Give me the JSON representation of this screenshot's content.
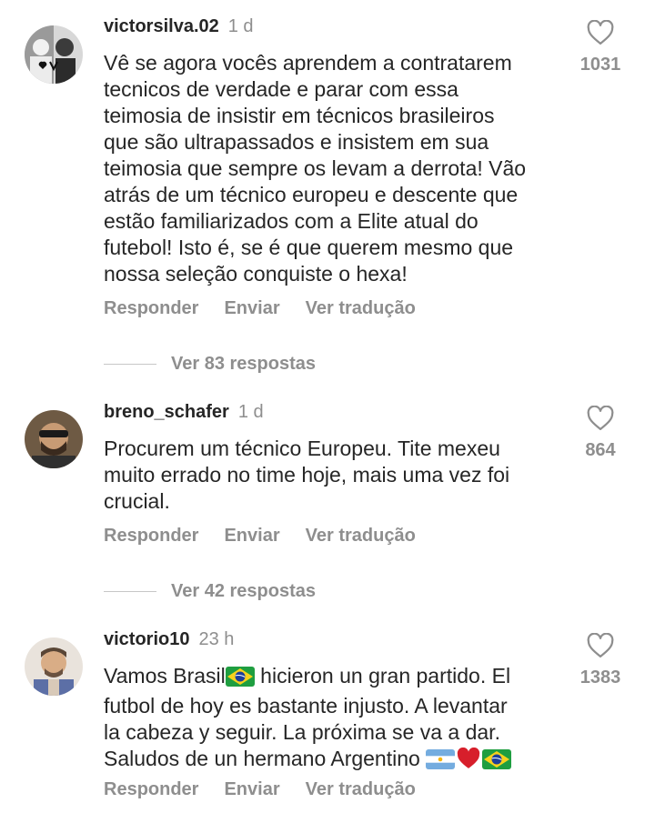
{
  "comments": [
    {
      "username": "victorsilva.02",
      "time": "1 d",
      "text": "Vê se agora vocês aprendem a contratarem\ntecnicos de verdade e parar com essa\nteimosia de insistir em técnicos brasileiros\nque são ultrapassados e insistem em sua\nteimosia que sempre os levam a derrota! Vão\natrás de um técnico europeu e descente que\nestão familiarizados com a Elite atual do\nfutebol! Isto é, se é que querem mesmo que\nnossa seleção conquiste o hexa!",
      "likes": "1031",
      "view_replies": "Ver 83 respostas"
    },
    {
      "username": "breno_schafer",
      "time": "1 d",
      "text": "Procurem um técnico Europeu. Tite mexeu\nmuito errado no time hoje, mais uma vez foi\ncrucial.",
      "likes": "864",
      "view_replies": "Ver 42 respostas"
    },
    {
      "username": "victorio10",
      "time": "23 h",
      "text_part1": "Vamos Brasil",
      "text_part2": " hicieron un gran partido. El\nfutbol de hoy es bastante injusto. A levantar\nla cabeza y seguir. La próxima se va a dar.\nSaludos de un hermano Argentino ",
      "emojis_end": [
        "argentina-flag",
        "red-heart",
        "brazil-flag"
      ],
      "likes": "1383"
    }
  ],
  "actions": {
    "reply": "Responder",
    "send": "Enviar",
    "translate": "Ver tradução"
  },
  "icons": {
    "like": "heart-outline-icon"
  },
  "colors": {
    "text": "#262626",
    "muted": "#8e8e8e",
    "divider": "#c7c7c7",
    "background": "#ffffff"
  }
}
